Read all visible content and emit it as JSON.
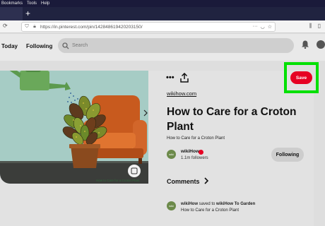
{
  "menubar": {
    "items": [
      "Bookmarks",
      "Tools",
      "Help"
    ]
  },
  "browser": {
    "newtab": "+",
    "url": "https://in.pinterest.com/pin/142848619420203150/"
  },
  "header": {
    "today": "Today",
    "following": "Following",
    "search_placeholder": "Search"
  },
  "pin": {
    "save_label": "Save",
    "more_label": "•••",
    "source": "wikihow.com",
    "title": "How to Care for a Croton Plant",
    "description": "How to Care for a Croton Plant",
    "author": "wikiHow",
    "followers": "1.1m followers",
    "follow_label": "Following",
    "comments_label": "Comments",
    "activity_user": "wikiHow",
    "activity_mid": " saved to ",
    "activity_board": "wikiHow To Garden",
    "activity_desc": "How to Care for a Croton Plant",
    "avatar_text": "wiki",
    "image_caption": "How to Care for a Croton Plant"
  },
  "colors": {
    "save": "#e60023",
    "highlight": "#00e000",
    "illustration_bg": "#a6ccc5"
  }
}
